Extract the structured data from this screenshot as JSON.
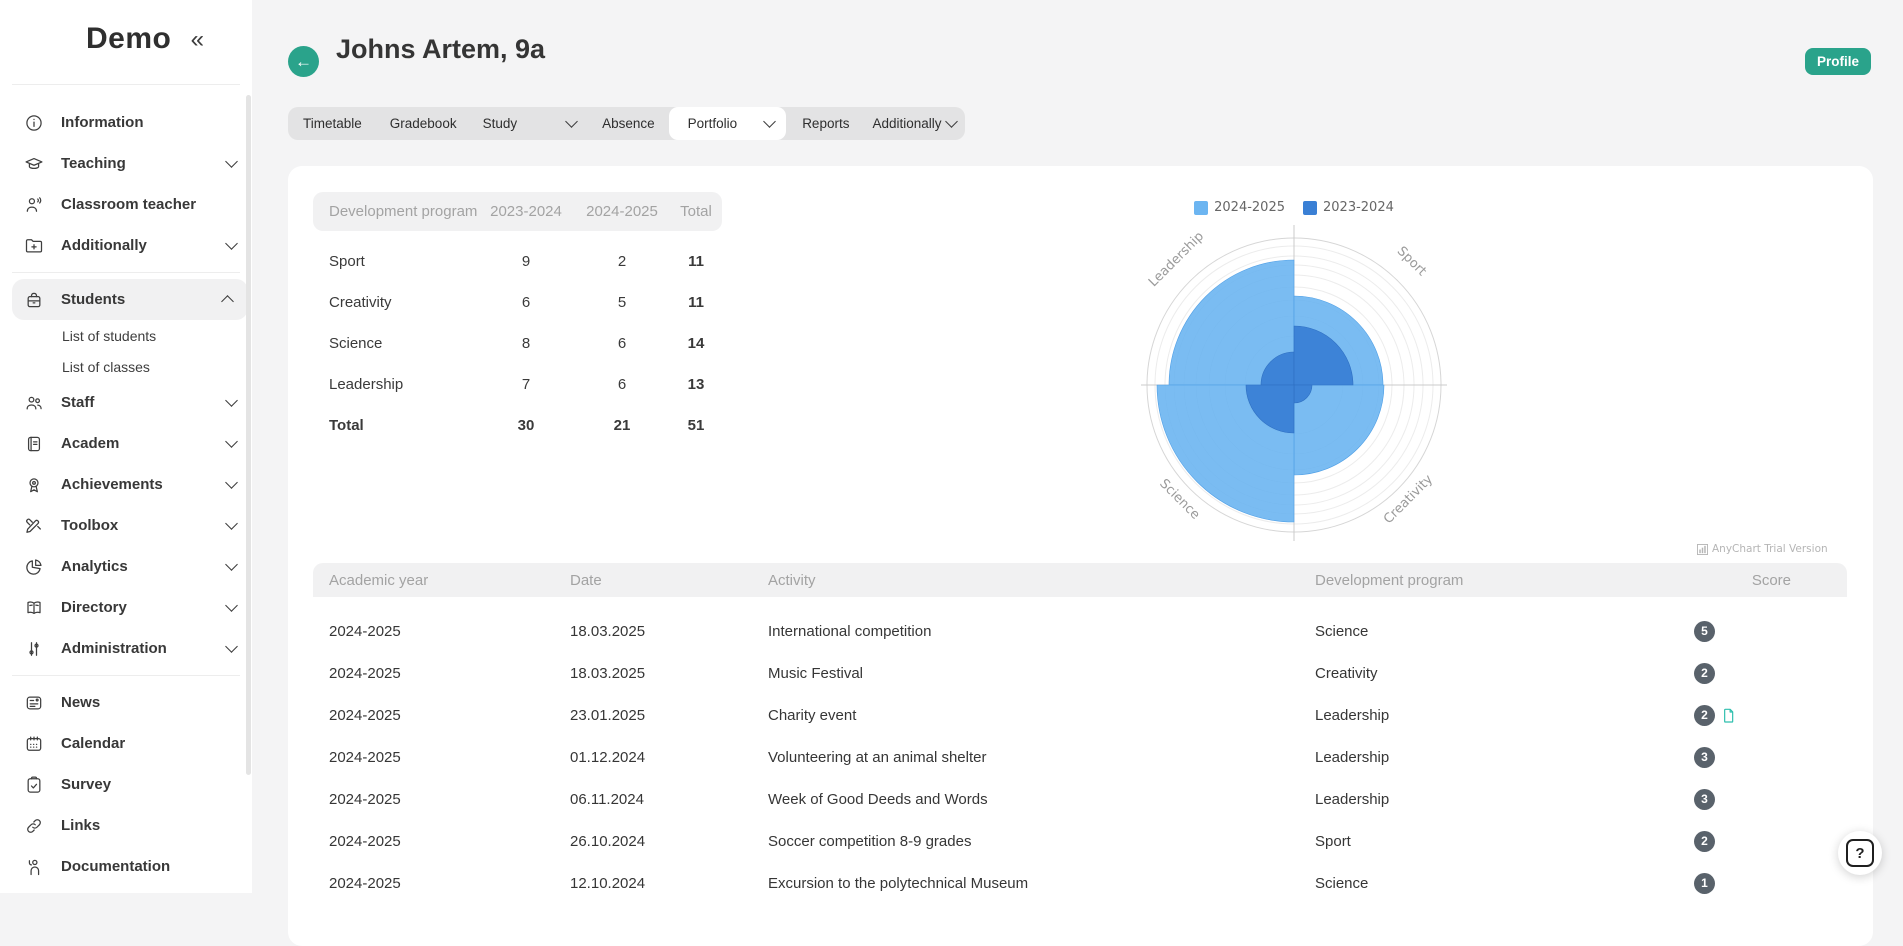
{
  "sidebar": {
    "logo": "Demo",
    "collapse_icon": "«",
    "items": [
      {
        "label": "Information",
        "icon": "info"
      },
      {
        "label": "Teaching",
        "icon": "graduation-cap",
        "expandable": true
      },
      {
        "label": "Classroom teacher",
        "icon": "person-speaking"
      },
      {
        "label": "Additionally",
        "icon": "folder-plus",
        "expandable": true
      },
      {
        "label": "Students",
        "icon": "backpack",
        "expandable": true,
        "expanded": true,
        "active": true,
        "children": [
          {
            "label": "List of students"
          },
          {
            "label": "List of classes"
          }
        ]
      },
      {
        "label": "Staff",
        "icon": "people",
        "expandable": true
      },
      {
        "label": "Academ",
        "icon": "journal",
        "expandable": true
      },
      {
        "label": "Achievements",
        "icon": "medal",
        "expandable": true
      },
      {
        "label": "Toolbox",
        "icon": "pencils",
        "expandable": true
      },
      {
        "label": "Analytics",
        "icon": "pie-chart",
        "expandable": true
      },
      {
        "label": "Directory",
        "icon": "open-book",
        "expandable": true
      },
      {
        "label": "Administration",
        "icon": "sliders",
        "expandable": true
      },
      {
        "label": "News",
        "icon": "newspaper"
      },
      {
        "label": "Calendar",
        "icon": "calendar"
      },
      {
        "label": "Survey",
        "icon": "clipboard-check"
      },
      {
        "label": "Links",
        "icon": "chain"
      },
      {
        "label": "Documentation",
        "icon": "person-raising-hand"
      }
    ]
  },
  "header": {
    "title": "Johns Artem, 9a",
    "profile_button": "Profile"
  },
  "tabs": {
    "active": "Portfolio",
    "items": [
      {
        "label": "Timetable"
      },
      {
        "label": "Gradebook"
      },
      {
        "label": "Study",
        "dropdown": true
      },
      {
        "label": "Absence"
      },
      {
        "label": "Portfolio",
        "dropdown": true,
        "active": true
      },
      {
        "label": "Reports"
      },
      {
        "label": "Additionally",
        "dropdown": true
      }
    ]
  },
  "summary_table": {
    "headers": [
      "Development program",
      "2023-2024",
      "2024-2025",
      "Total"
    ],
    "rows": [
      [
        "Sport",
        "9",
        "2",
        "11"
      ],
      [
        "Creativity",
        "6",
        "5",
        "11"
      ],
      [
        "Science",
        "8",
        "6",
        "14"
      ],
      [
        "Leadership",
        "7",
        "6",
        "13"
      ]
    ],
    "total_row": [
      "Total",
      "30",
      "21",
      "51"
    ]
  },
  "chart": {
    "legend": [
      {
        "label": "2024-2025",
        "color": "#6cb5f1"
      },
      {
        "label": "2023-2024",
        "color": "#3a80d5"
      }
    ],
    "axis_labels": {
      "top_left": "Leadership",
      "top_right": "Sport",
      "bottom_right": "Creativity",
      "bottom_left": "Science"
    },
    "watermark": "AnyChart Trial Version"
  },
  "chart_data": {
    "type": "bar",
    "subtype": "polar-quadrant-columns",
    "categories": [
      "Sport",
      "Creativity",
      "Science",
      "Leadership"
    ],
    "series": [
      {
        "name": "2024-2025",
        "color": "#6cb5f1",
        "values": [
          2,
          5,
          6,
          6
        ]
      },
      {
        "name": "2023-2024",
        "color": "#3a80d5",
        "values": [
          9,
          6,
          8,
          7
        ]
      }
    ],
    "legend_position": "top",
    "grid": true,
    "watermark": "AnyChart Trial Version"
  },
  "activities_table": {
    "headers": [
      "Academic year",
      "Date",
      "Activity",
      "Development program",
      "Score"
    ],
    "rows": [
      {
        "year": "2024-2025",
        "date": "18.03.2025",
        "activity": "International competition",
        "program": "Science",
        "score": "5"
      },
      {
        "year": "2024-2025",
        "date": "18.03.2025",
        "activity": "Music Festival",
        "program": "Creativity",
        "score": "2"
      },
      {
        "year": "2024-2025",
        "date": "23.01.2025",
        "activity": "Charity event",
        "program": "Leadership",
        "score": "2",
        "attachment": true
      },
      {
        "year": "2024-2025",
        "date": "01.12.2024",
        "activity": "Volunteering at an animal shelter",
        "program": "Leadership",
        "score": "3"
      },
      {
        "year": "2024-2025",
        "date": "06.11.2024",
        "activity": "Week of Good Deeds and Words",
        "program": "Leadership",
        "score": "3"
      },
      {
        "year": "2024-2025",
        "date": "26.10.2024",
        "activity": "Soccer competition 8-9 grades",
        "program": "Sport",
        "score": "2"
      },
      {
        "year": "2024-2025",
        "date": "12.10.2024",
        "activity": "Excursion to the polytechnical Museum",
        "program": "Science",
        "score": "1"
      }
    ]
  },
  "help_button": {
    "label": "?"
  },
  "colors": {
    "accent_teal": "#2aa38b",
    "badge_gray": "#59626b",
    "attachment_teal": "#2fbfae",
    "chart_light_blue": "#6cb5f1",
    "chart_dark_blue": "#3a80d5"
  }
}
